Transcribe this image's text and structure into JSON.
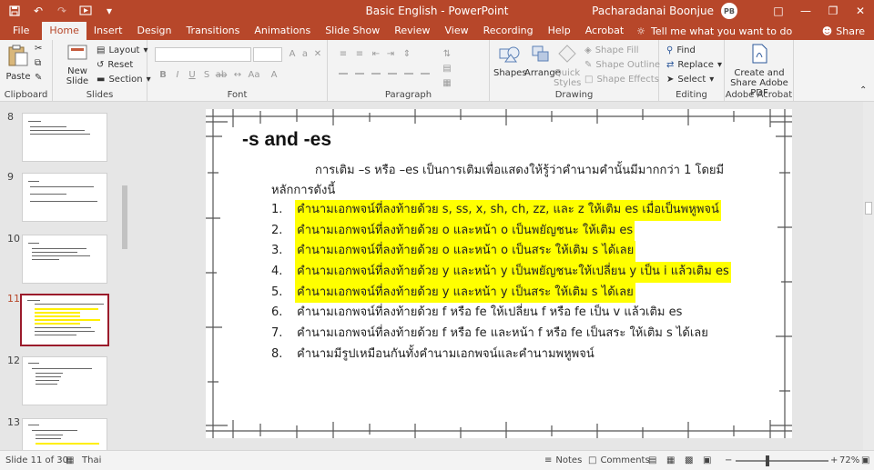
{
  "app": {
    "title": "Basic English  -  PowerPoint",
    "user_name": "Pacharadanai Boonjue",
    "user_initials": "PB",
    "accent": "#b7472a"
  },
  "tabs": [
    "File",
    "Home",
    "Insert",
    "Design",
    "Transitions",
    "Animations",
    "Slide Show",
    "Review",
    "View",
    "Recording",
    "Help",
    "Acrobat"
  ],
  "active_tab": "Home",
  "tell_me": "Tell me what you want to do",
  "share": "Share",
  "ribbon": {
    "clipboard": {
      "label": "Clipboard",
      "paste": "Paste"
    },
    "slides": {
      "label": "Slides",
      "new_slide": "New Slide",
      "layout": "Layout",
      "reset": "Reset",
      "section": "Section"
    },
    "font": {
      "label": "Font"
    },
    "paragraph": {
      "label": "Paragraph"
    },
    "drawing": {
      "label": "Drawing",
      "shapes": "Shapes",
      "arrange": "Arrange",
      "quick_styles": "Quick Styles",
      "shape_fill": "Shape Fill",
      "shape_outline": "Shape Outline",
      "shape_effects": "Shape Effects"
    },
    "editing": {
      "label": "Editing",
      "find": "Find",
      "replace": "Replace",
      "select": "Select"
    },
    "acrobat": {
      "label": "Adobe Acrobat",
      "create_share": "Create and Share Adobe PDF"
    }
  },
  "thumbnails": [
    {
      "num": "8",
      "selected": false
    },
    {
      "num": "9",
      "selected": false
    },
    {
      "num": "10",
      "selected": false
    },
    {
      "num": "11",
      "selected": true
    },
    {
      "num": "12",
      "selected": false
    },
    {
      "num": "13",
      "selected": false
    }
  ],
  "slide": {
    "title": "-s and -es",
    "intro_line1": "การเติม –s หรือ –es เป็นการเติมเพื่อแสดงให้รู้ว่าคำนามคำนั้นมีมากกว่า 1 โดยมี",
    "intro_line2": "หลักการดังนี้",
    "items": [
      {
        "num": "1.",
        "text": "คำนามเอกพจน์ที่ลงท้ายด้วย s, ss, x, sh, ch, zz, และ z ให้เติม es เมื่อเป็นพหูพจน์",
        "highlight": true
      },
      {
        "num": "2.",
        "text": "คำนามเอกพจน์ที่ลงท้ายด้วย o และหน้า o เป็นพยัญชนะ ให้เติม es",
        "highlight": true
      },
      {
        "num": "3.",
        "text": "คำนามเอกพจน์ที่ลงท้ายด้วย o และหน้า o เป็นสระ ให้เติม s ได้เลย",
        "highlight": true
      },
      {
        "num": "4.",
        "text": "คำนามเอกพจน์ที่ลงท้ายด้วย y และหน้า y เป็นพยัญชนะให้เปลี่ยน y เป็น i แล้วเติม es",
        "highlight": true
      },
      {
        "num": "5.",
        "text": "คำนามเอกพจน์ที่ลงท้ายด้วย y และหน้า y เป็นสระ ให้เติม s ได้เลย",
        "highlight": true
      },
      {
        "num": "6.",
        "text": "คำนามเอกพจน์ที่ลงท้ายด้วย f หรือ fe  ให้เปลี่ยน f หรือ fe เป็น v แล้วเติม es",
        "highlight": false
      },
      {
        "num": "7.",
        "text": "คำนามเอกพจน์ที่ลงท้ายด้วย f หรือ fe และหน้า f หรือ fe เป็นสระ ให้เติม s ได้เลย",
        "highlight": false
      },
      {
        "num": "8.",
        "text": "คำนามมีรูปเหมือนกันทั้งคำนามเอกพจน์และคำนามพหูพจน์",
        "highlight": false
      }
    ]
  },
  "status": {
    "slide_info": "Slide 11 of 30",
    "language": "Thai",
    "notes": "Notes",
    "comments": "Comments",
    "zoom": "72%",
    "zoom_level": 0.72
  }
}
